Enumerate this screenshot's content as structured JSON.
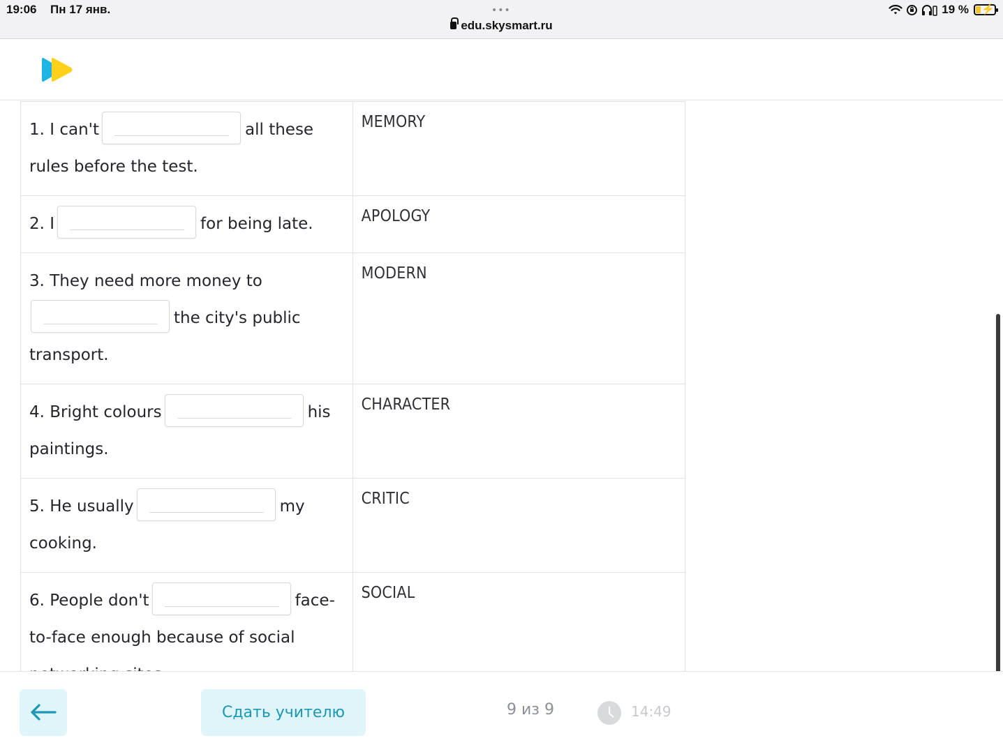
{
  "status_bar": {
    "time": "19:06",
    "date": "Пн 17 янв.",
    "dots": "•••",
    "url": "edu.skysmart.ru",
    "battery": "19 %",
    "icons": [
      "wifi-icon",
      "orientation-lock-icon",
      "headphones-icon",
      "battery-icon"
    ]
  },
  "header": {
    "logo": "skysmart-logo",
    "logo_colors": [
      "#1fb4e6",
      "#ffd11a"
    ]
  },
  "exercise": {
    "rows": [
      {
        "before": "1. I can't",
        "after": "all these rules before the test.",
        "word": "MEMORY"
      },
      {
        "before": "2. I",
        "after": "for being late.",
        "word": "APOLOGY"
      },
      {
        "before": "3. They need more money to",
        "after": "the city's public transport.",
        "word": "MODERN"
      },
      {
        "before": "4. Bright colours",
        "after": "his paintings.",
        "word": "CHARACTER"
      },
      {
        "before": "5. He usually",
        "after": "my cooking.",
        "word": "CRITIC"
      },
      {
        "before": "6. People don't",
        "after": "face-to-face enough because of social networking sites.",
        "word": "SOCIAL"
      }
    ]
  },
  "footer": {
    "back_icon": "arrow-left-icon",
    "submit_label": "Сдать учителю",
    "page_counter": "9 из 9",
    "timer": "14:49",
    "accent_color": "#1a98b4",
    "button_bg": "#dff5fa"
  }
}
